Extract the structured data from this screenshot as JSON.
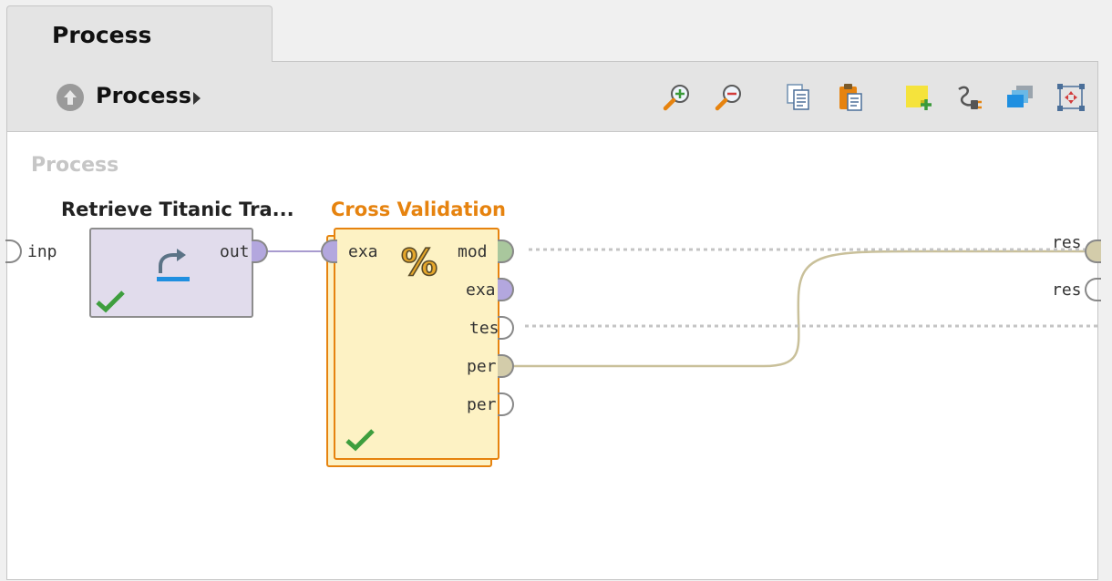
{
  "tab": {
    "label": "Process"
  },
  "toolbar": {
    "breadcrumb": "Process",
    "buttons": [
      {
        "icon": "zoom-in-icon"
      },
      {
        "icon": "zoom-out-icon"
      },
      {
        "icon": "copy-icon"
      },
      {
        "icon": "paste-icon"
      },
      {
        "icon": "add-note-icon"
      },
      {
        "icon": "auto-wire-icon"
      },
      {
        "icon": "arrange-icon"
      },
      {
        "icon": "fit-view-icon"
      }
    ]
  },
  "canvas": {
    "process_label": "Process",
    "process_input_port": "inp",
    "process_output_ports": [
      "res",
      "res"
    ],
    "operators": {
      "retrieve": {
        "title": "Retrieve Titanic Tra...",
        "output_port": "out",
        "status": "ok"
      },
      "cross_validation": {
        "title": "Cross Validation",
        "input_port": "exa",
        "output_ports": [
          "mod",
          "exa",
          "tes",
          "per",
          "per"
        ],
        "status": "ok"
      }
    }
  },
  "colors": {
    "accent_orange": "#e6830f",
    "example_port": "#b3a7de",
    "model_port": "#a9c79d",
    "performance_port": "#d3ccaa",
    "wire_example": "#a89bcf",
    "wire_performance": "#c9c09a",
    "check_green": "#3e9e3e"
  }
}
